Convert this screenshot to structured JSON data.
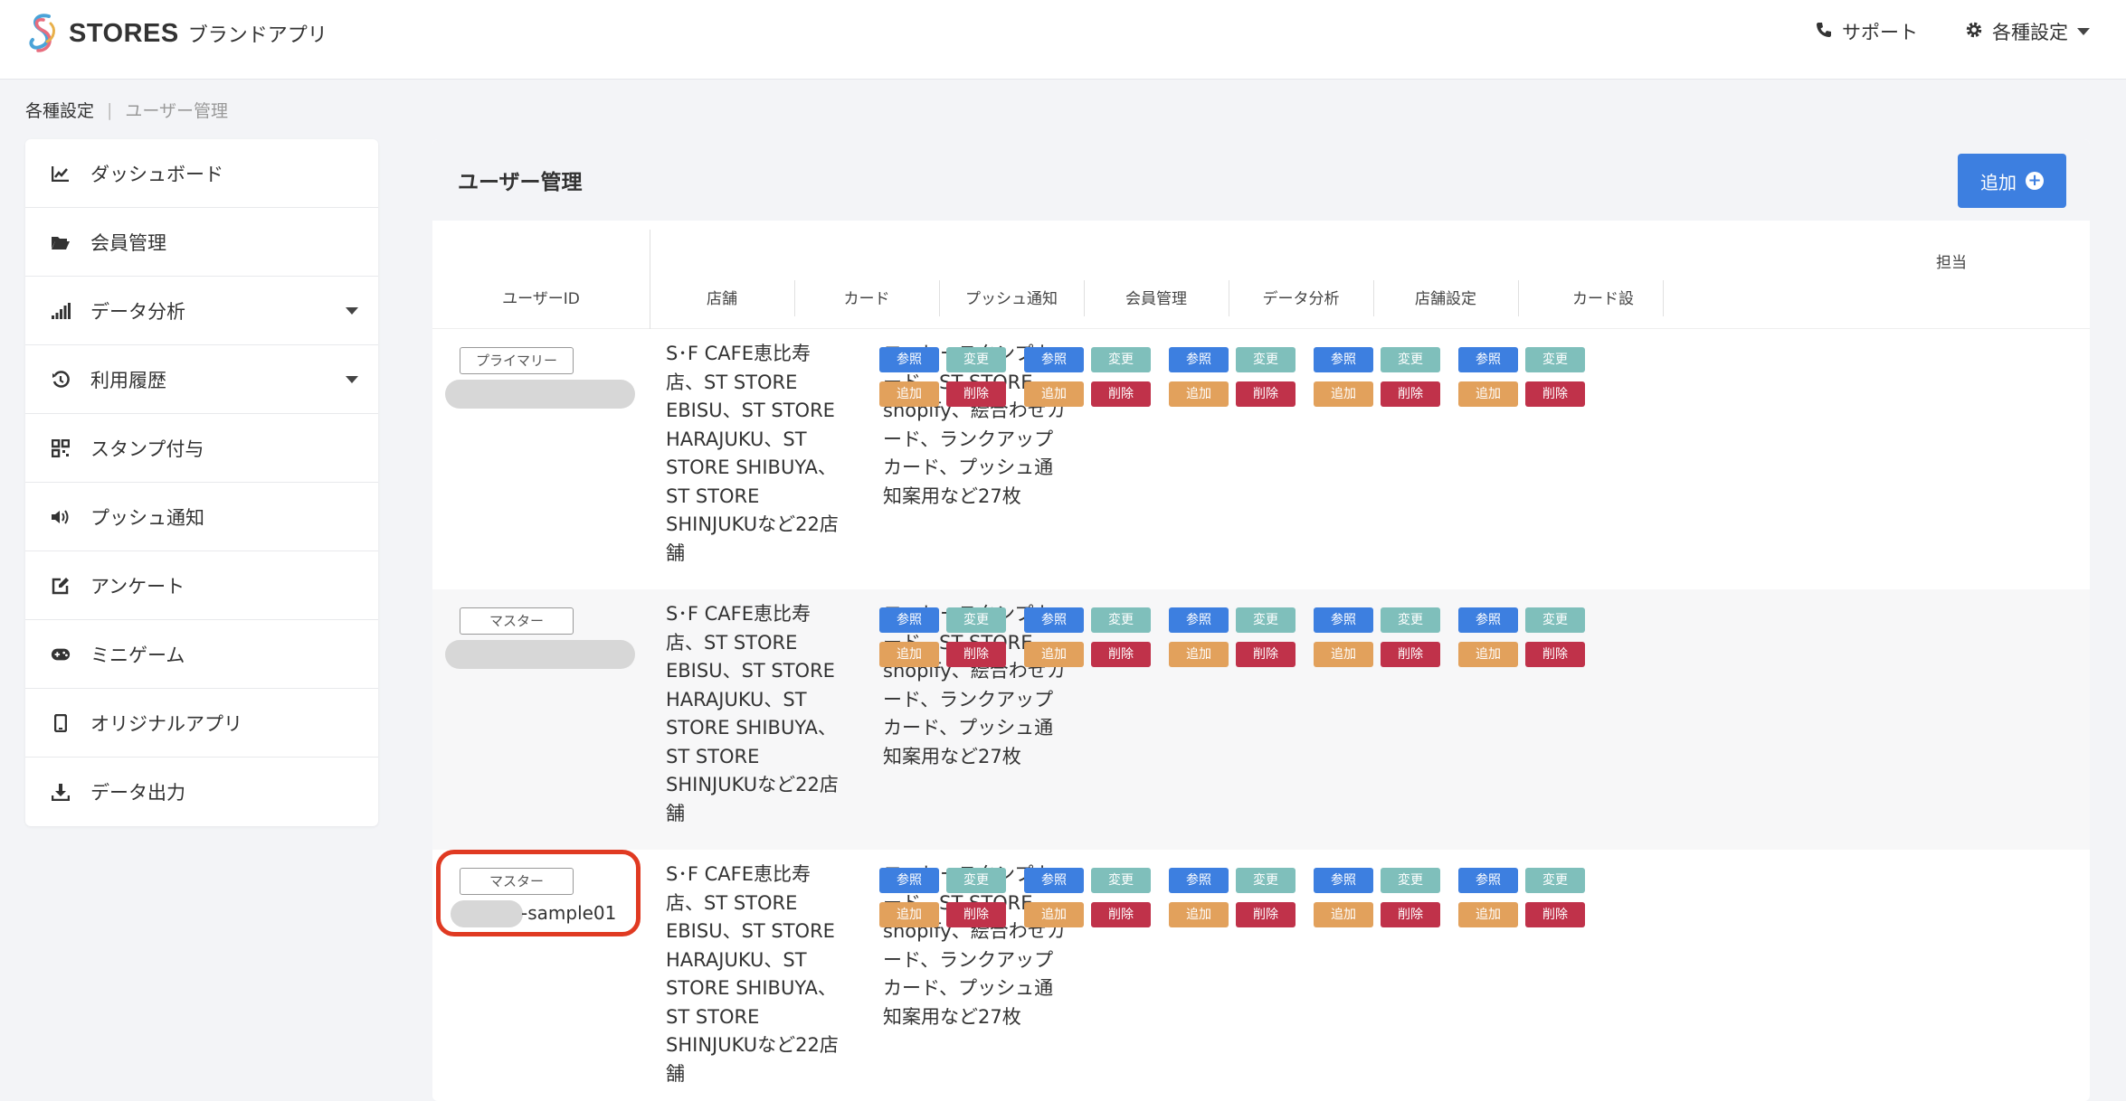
{
  "header": {
    "brand": "STORES",
    "brand_sub": "ブランドアプリ",
    "support_label": "サポート",
    "settings_label": "各種設定"
  },
  "breadcrumb": {
    "parent": "各種設定",
    "current": "ユーザー管理"
  },
  "sidebar": {
    "items": [
      {
        "label": "ダッシュボード",
        "icon": "chart-line-icon"
      },
      {
        "label": "会員管理",
        "icon": "folder-open-icon"
      },
      {
        "label": "データ分析",
        "icon": "signal-bars-icon",
        "has_caret": true
      },
      {
        "label": "利用履歴",
        "icon": "history-icon",
        "has_caret": true
      },
      {
        "label": "スタンプ付与",
        "icon": "qrcode-icon"
      },
      {
        "label": "プッシュ通知",
        "icon": "volume-icon"
      },
      {
        "label": "アンケート",
        "icon": "edit-icon"
      },
      {
        "label": "ミニゲーム",
        "icon": "gamepad-icon"
      },
      {
        "label": "オリジナルアプリ",
        "icon": "mobile-icon"
      },
      {
        "label": "データ出力",
        "icon": "download-icon"
      }
    ]
  },
  "main": {
    "title": "ユーザー管理",
    "add_label": "追加",
    "group_header": "担当",
    "columns": [
      "ユーザーID",
      "店舗",
      "カード",
      "プッシュ通知",
      "会員管理",
      "データ分析",
      "店舗設定",
      "カード設"
    ],
    "perm_labels": {
      "view": "参照",
      "edit": "変更",
      "add": "追加",
      "delete": "削除"
    },
    "rows": [
      {
        "role": "プライマリー",
        "user_id_suffix": "",
        "stores_lines": [
          "S･F CAFE恵比寿",
          "店、ST STORE",
          "EBISU、ST STORE",
          "HARAJUKU、ST",
          "STORE SHIBUYA、",
          "ST STORE",
          "SHINJUKUなど22店",
          "舗"
        ],
        "cards_lines": [
          "コーヒースタンプカ",
          "ード、ST STORE",
          "shopify、絵合わせカ",
          "ード、ランクアップ",
          "カード、プッシュ通",
          "知案用など27枚"
        ]
      },
      {
        "role": "マスター",
        "user_id_suffix": "",
        "stores_lines": [
          "S･F CAFE恵比寿",
          "店、ST STORE",
          "EBISU、ST STORE",
          "HARAJUKU、ST",
          "STORE SHIBUYA、",
          "ST STORE",
          "SHINJUKUなど22店",
          "舗"
        ],
        "cards_lines": [
          "コーヒースタンプカ",
          "ード、ST STORE",
          "shopify、絵合わせカ",
          "ード、ランクアップ",
          "カード、プッシュ通",
          "知案用など27枚"
        ]
      },
      {
        "role": "マスター",
        "user_id_suffix": "-sample01",
        "stores_lines": [
          "S･F CAFE恵比寿",
          "店、ST STORE",
          "EBISU、ST STORE",
          "HARAJUKU、ST",
          "STORE SHIBUYA、",
          "ST STORE",
          "SHINJUKUなど22店",
          "舗"
        ],
        "cards_lines": [
          "コーヒースタンプカ",
          "ード、ST STORE",
          "shopify、絵合わせカ",
          "ード、ランクアップ",
          "カード、プッシュ通",
          "知案用など27枚"
        ]
      }
    ]
  },
  "colors": {
    "primary": "#3d7fe0",
    "edit": "#7fbfbb",
    "add": "#e2a15c",
    "delete": "#c0324a",
    "highlight": "#e03a22"
  }
}
